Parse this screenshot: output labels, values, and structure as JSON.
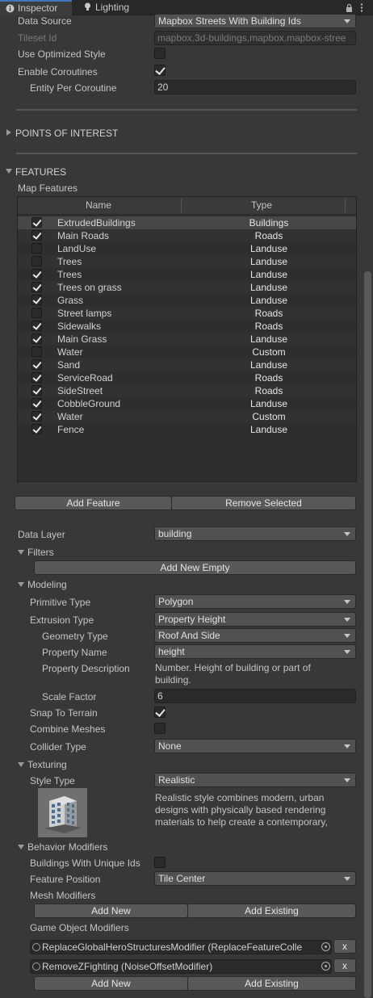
{
  "tabs": {
    "inspector": "Inspector",
    "lighting": "Lighting"
  },
  "top": {
    "data_source_label": "Data Source",
    "data_source_value": "Mapbox Streets With Building Ids",
    "tileset_label": "Tileset Id",
    "tileset_value": "mapbox.3d-buildings,mapbox.mapbox-stree",
    "optimized_label": "Use Optimized Style",
    "optimized_checked": false,
    "coroutines_label": "Enable Coroutines",
    "coroutines_checked": true,
    "entity_label": "Entity Per Coroutine",
    "entity_value": "20"
  },
  "poi_label": "POINTS OF INTEREST",
  "features_label": "FEATURES",
  "map_features_label": "Map Features",
  "table": {
    "col_name": "Name",
    "col_type": "Type",
    "rows": [
      {
        "checked": true,
        "name": "ExtrudedBuildings",
        "type": "Buildings"
      },
      {
        "checked": true,
        "name": "Main Roads",
        "type": "Roads"
      },
      {
        "checked": false,
        "name": "LandUse",
        "type": "Landuse"
      },
      {
        "checked": false,
        "name": "Trees",
        "type": "Landuse"
      },
      {
        "checked": true,
        "name": "Trees",
        "type": "Landuse"
      },
      {
        "checked": true,
        "name": "Trees on grass",
        "type": "Landuse"
      },
      {
        "checked": true,
        "name": "Grass",
        "type": "Landuse"
      },
      {
        "checked": false,
        "name": "Street lamps",
        "type": "Roads"
      },
      {
        "checked": true,
        "name": "Sidewalks",
        "type": "Roads"
      },
      {
        "checked": true,
        "name": "Main Grass",
        "type": "Landuse"
      },
      {
        "checked": false,
        "name": "Water",
        "type": "Custom"
      },
      {
        "checked": true,
        "name": "Sand",
        "type": "Landuse"
      },
      {
        "checked": true,
        "name": "ServiceRoad",
        "type": "Roads"
      },
      {
        "checked": true,
        "name": "SideStreet",
        "type": "Roads"
      },
      {
        "checked": true,
        "name": "CobbleGround",
        "type": "Landuse"
      },
      {
        "checked": true,
        "name": "Water",
        "type": "Custom"
      },
      {
        "checked": true,
        "name": "Fence",
        "type": "Landuse"
      }
    ]
  },
  "buttons": {
    "add_feature": "Add Feature",
    "remove_selected": "Remove Selected",
    "add_new_empty": "Add New Empty",
    "add_new": "Add New",
    "add_existing": "Add Existing",
    "remove_x": "x"
  },
  "data_layer": {
    "label": "Data Layer",
    "value": "building"
  },
  "filters_label": "Filters",
  "modeling": {
    "label": "Modeling",
    "primitive_label": "Primitive Type",
    "primitive_value": "Polygon",
    "extrusion_label": "Extrusion Type",
    "extrusion_value": "Property Height",
    "geometry_label": "Geometry Type",
    "geometry_value": "Roof And Side",
    "property_name_label": "Property Name",
    "property_name_value": "height",
    "property_desc_label": "Property Description",
    "property_desc_line1": "Number. Height of building or part of",
    "property_desc_line2": "building.",
    "scale_label": "Scale Factor",
    "scale_value": "6",
    "snap_label": "Snap To Terrain",
    "snap_checked": true,
    "combine_label": "Combine Meshes",
    "combine_checked": false,
    "collider_label": "Collider Type",
    "collider_value": "None"
  },
  "texturing": {
    "label": "Texturing",
    "style_label": "Style Type",
    "style_value": "Realistic",
    "desc_line1": "Realistic style combines modern, urban",
    "desc_line2": "designs with physically based rendering",
    "desc_line3": "materials to help create a contemporary,"
  },
  "behavior": {
    "label": "Behavior Modifiers",
    "unique_ids_label": "Buildings With Unique Ids",
    "unique_ids_checked": false,
    "feature_position_label": "Feature Position",
    "feature_position_value": "Tile Center",
    "mesh_modifiers_label": "Mesh Modifiers",
    "go_modifiers_label": "Game Object Modifiers",
    "modifier1": "ReplaceGlobalHeroStructuresModifier (ReplaceFeatureColle",
    "modifier2": "RemoveZFighting (NoiseOffsetModifier)"
  },
  "colors": {
    "accent": "#3a79bb",
    "panel": "#383838",
    "field": "#2a2a2a"
  }
}
